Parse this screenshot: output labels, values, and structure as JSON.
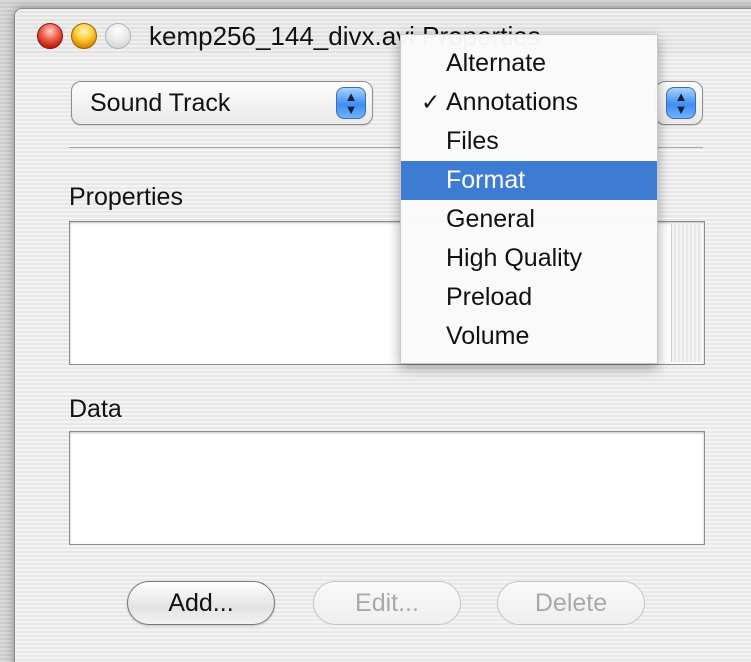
{
  "window": {
    "title": "kemp256_144_divx.avi Properties"
  },
  "track_popup": {
    "selected": "Sound Track",
    "arrows": "▲\n▼"
  },
  "category_popup": {
    "arrows": "▲\n▼"
  },
  "properties": {
    "label": "Properties"
  },
  "data_section": {
    "label": "Data"
  },
  "buttons": {
    "add": "Add...",
    "edit": "Edit...",
    "delete": "Delete"
  },
  "menu": {
    "check_glyph": "✓",
    "items": [
      {
        "label": "Alternate",
        "checked": false,
        "highlighted": false
      },
      {
        "label": "Annotations",
        "checked": true,
        "highlighted": false
      },
      {
        "label": "Files",
        "checked": false,
        "highlighted": false
      },
      {
        "label": "Format",
        "checked": false,
        "highlighted": true
      },
      {
        "label": "General",
        "checked": false,
        "highlighted": false
      },
      {
        "label": "High Quality",
        "checked": false,
        "highlighted": false
      },
      {
        "label": "Preload",
        "checked": false,
        "highlighted": false
      },
      {
        "label": "Volume",
        "checked": false,
        "highlighted": false
      }
    ]
  },
  "colors": {
    "highlight": "#3d7cd2",
    "close": "#e0412c",
    "minimize": "#f7b21b"
  }
}
